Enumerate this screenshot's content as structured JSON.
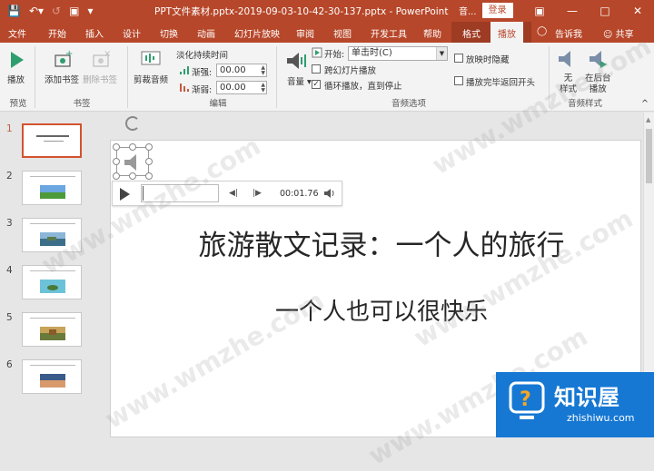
{
  "window": {
    "doc_title": "PPT文件素材.pptx-2019-09-03-10-42-30-137.pptx  -  PowerPoint",
    "context_label": "音...",
    "login_label": "登录",
    "accent": "#b7472a"
  },
  "tabs": [
    "文件",
    "开始",
    "插入",
    "设计",
    "切换",
    "动画",
    "幻灯片放映",
    "审阅",
    "视图",
    "开发工具",
    "帮助",
    "格式",
    "播放"
  ],
  "active_tab": "播放",
  "tell_me": "告诉我",
  "share": "共享",
  "ribbon": {
    "preview": {
      "button": "播放",
      "group": "预览"
    },
    "bookmarks": {
      "add": "添加书签",
      "remove": "删除书签",
      "group": "书签"
    },
    "editing": {
      "trim": "剪裁音频",
      "fade_title": "淡化持续时间",
      "fade_in_label": "渐强:",
      "fade_in_value": "00.00",
      "fade_out_label": "渐弱:",
      "fade_out_value": "00.00",
      "group": "编辑"
    },
    "audio_options": {
      "volume": "音量",
      "start_label": "开始:",
      "start_value": "单击时(C)",
      "play_across": "跨幻灯片播放",
      "loop": "循环播放，直到停止",
      "hide": "放映时隐藏",
      "rewind": "播放完毕返回开头",
      "play_across_checked": false,
      "loop_checked": true,
      "hide_checked": false,
      "rewind_checked": false,
      "group": "音频选项"
    },
    "audio_styles": {
      "none": "无\n样式",
      "none_l1": "无",
      "none_l2": "样式",
      "bg_l1": "在后台",
      "bg_l2": "播放",
      "group": "音频样式"
    }
  },
  "slides": [
    {
      "num": "1"
    },
    {
      "num": "2"
    },
    {
      "num": "3"
    },
    {
      "num": "4"
    },
    {
      "num": "5"
    },
    {
      "num": "6"
    }
  ],
  "current_slide": {
    "title": "旅游散文记录：一个人的旅行",
    "subtitle": "一个人也可以很快乐"
  },
  "player": {
    "time": "00:01.76"
  },
  "watermarks": [
    "www.wmzhe.com",
    "www.wmzhe.com",
    "www.wmzhe.com",
    "www.wmzhe.com",
    "www.wmzhe.com"
  ],
  "logo": {
    "cn": "知识屋",
    "en": "zhishiwu.com"
  }
}
